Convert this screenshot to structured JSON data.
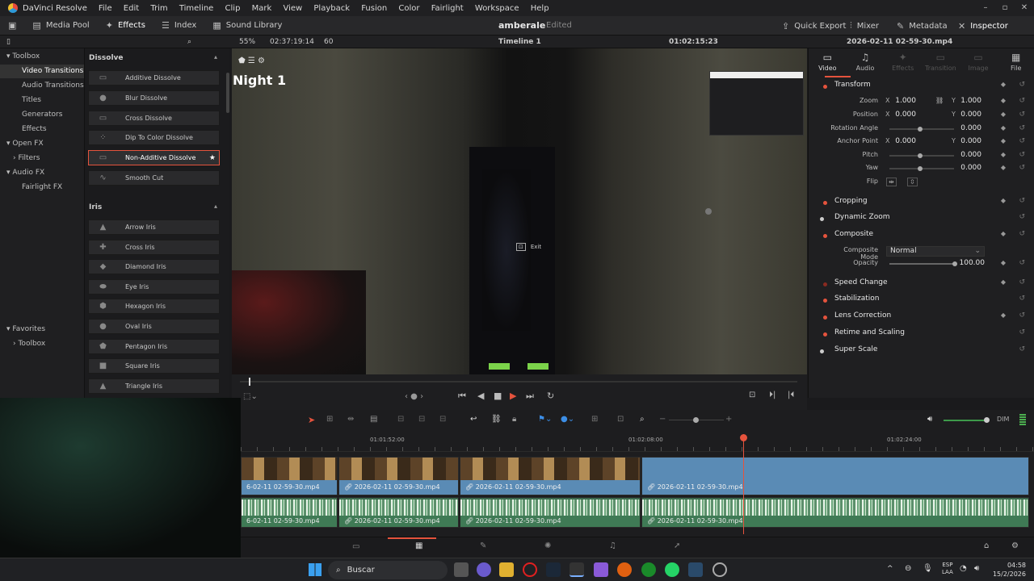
{
  "titlebar": {
    "app": "DaVinci Resolve",
    "menu": [
      "File",
      "Edit",
      "Trim",
      "Timeline",
      "Clip",
      "Mark",
      "View",
      "Playback",
      "Fusion",
      "Color",
      "Fairlight",
      "Workspace",
      "Help"
    ]
  },
  "toolbar": {
    "media_pool": "Media Pool",
    "effects": "Effects",
    "index": "Index",
    "sound_library": "Sound Library",
    "project": "amberale",
    "status": "Edited",
    "quick_export": "Quick Export",
    "mixer": "Mixer",
    "metadata": "Metadata",
    "inspector": "Inspector"
  },
  "subbar": {
    "zoom": "55%",
    "timecode_source": "02:37:19:14",
    "fps": "60",
    "timeline_name": "Timeline 1",
    "timecode_record": "01:02:15:23",
    "clip_name": "2026-02-11 02-59-30.mp4"
  },
  "leftnav": {
    "toolbox": "Toolbox",
    "video_transitions": "Video Transitions",
    "audio_transitions": "Audio Transitions",
    "titles": "Titles",
    "generators": "Generators",
    "effects": "Effects",
    "open_fx": "Open FX",
    "filters": "Filters",
    "audio_fx": "Audio FX",
    "fairlight_fx": "Fairlight FX",
    "favorites": "Favorites",
    "fav_toolbox": "Toolbox"
  },
  "fxlist": {
    "dissolve_title": "Dissolve",
    "dissolve": [
      "Additive Dissolve",
      "Blur Dissolve",
      "Cross Dissolve",
      "Dip To Color Dissolve",
      "Non-Additive Dissolve",
      "Smooth Cut"
    ],
    "iris_title": "Iris",
    "iris": [
      "Arrow Iris",
      "Cross Iris",
      "Diamond Iris",
      "Eye Iris",
      "Hexagon Iris",
      "Oval Iris",
      "Pentagon Iris",
      "Square Iris",
      "Triangle Iris"
    ]
  },
  "viewer": {
    "overlay_title": "Night 1",
    "exit_label": "Exit"
  },
  "inspector": {
    "tabs": [
      "Video",
      "Audio",
      "Effects",
      "Transition",
      "Image",
      "File"
    ],
    "transform": "Transform",
    "zoom_label": "Zoom",
    "zoom_x": "1.000",
    "zoom_y": "1.000",
    "position_label": "Position",
    "position_x": "0.000",
    "position_y": "0.000",
    "rotation_label": "Rotation Angle",
    "rotation": "0.000",
    "anchor_label": "Anchor Point",
    "anchor_x": "0.000",
    "anchor_y": "0.000",
    "pitch_label": "Pitch",
    "pitch": "0.000",
    "yaw_label": "Yaw",
    "yaw": "0.000",
    "flip_label": "Flip",
    "cropping": "Cropping",
    "dynamic_zoom": "Dynamic Zoom",
    "composite": "Composite",
    "composite_mode_label": "Composite Mode",
    "composite_mode": "Normal",
    "opacity_label": "Opacity",
    "opacity": "100.00",
    "speed_change": "Speed Change",
    "stabilization": "Stabilization",
    "lens_correction": "Lens Correction",
    "retime": "Retime and Scaling",
    "super_scale": "Super Scale"
  },
  "timeline": {
    "ruler": [
      "01:01:52:00",
      "01:02:08:00",
      "01:02:24:00"
    ],
    "dim": "DIM",
    "clip_first": "6-02-11 02-59-30.mp4",
    "clip": "2026-02-11 02-59-30.mp4"
  },
  "taskbar": {
    "search": "Buscar",
    "lang1": "ESP",
    "lang2": "LAA",
    "time": "04:58",
    "date": "15/2/2026"
  },
  "colors": {
    "accent": "#e5533d",
    "clip_blue": "#5a8bb5",
    "audio_green": "#3f7a55"
  }
}
